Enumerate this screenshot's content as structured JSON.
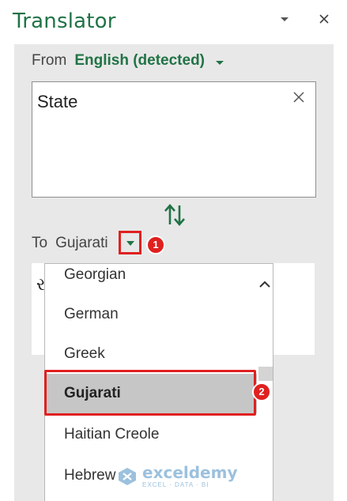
{
  "pane": {
    "title": "Translator"
  },
  "from": {
    "label": "From",
    "language": "English (detected)"
  },
  "source": {
    "text": "State"
  },
  "to": {
    "label": "To",
    "language": "Gujarati"
  },
  "target": {
    "glyph": "ર"
  },
  "dropdown": {
    "items": [
      {
        "label": "Georgian",
        "selected": false
      },
      {
        "label": "German",
        "selected": false
      },
      {
        "label": "Greek",
        "selected": false
      },
      {
        "label": "Gujarati",
        "selected": true
      },
      {
        "label": "Haitian Creole",
        "selected": false
      },
      {
        "label": "Hebrew",
        "selected": false
      }
    ]
  },
  "annotations": {
    "badge_1": "1",
    "badge_2": "2"
  },
  "watermark": {
    "name": "exceldemy",
    "tagline": "EXCEL · DATA · BI"
  },
  "colors": {
    "accent": "#217346",
    "annotation": "#e02020",
    "selected_bg": "#c6c6c6",
    "panel_bg": "#e8e8e8"
  },
  "icons": {
    "title_dropdown": "chevron-down-icon",
    "title_close": "close-icon",
    "from_caret": "caret-down-icon",
    "clear": "close-icon",
    "swap": "swap-vertical-icon",
    "to_caret": "caret-down-icon",
    "dropdown_up": "chevron-up-icon"
  }
}
